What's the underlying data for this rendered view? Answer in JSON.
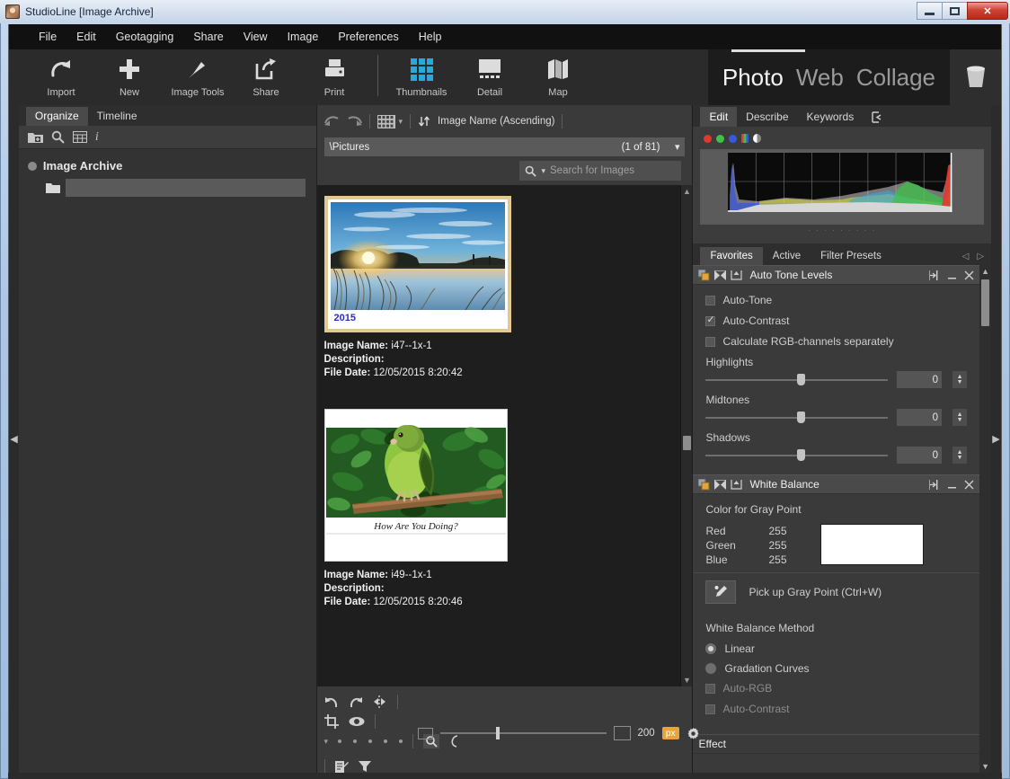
{
  "window": {
    "title": "StudioLine [Image Archive]",
    "buttons": {
      "minimize": "minimize",
      "maximize": "maximize",
      "close": "✕"
    }
  },
  "menubar": {
    "items": [
      "File",
      "Edit",
      "Geotagging",
      "Share",
      "View",
      "Image",
      "Preferences",
      "Help"
    ]
  },
  "toolbar": {
    "items": [
      {
        "label": "Import",
        "icon": "import-arrow-icon"
      },
      {
        "label": "New",
        "icon": "plus-icon"
      },
      {
        "label": "Image Tools",
        "icon": "wand-icon"
      },
      {
        "label": "Share",
        "icon": "share-export-icon"
      },
      {
        "label": "Print",
        "icon": "printer-icon"
      },
      {
        "label": "Thumbnails",
        "icon": "grid-icon"
      },
      {
        "label": "Detail",
        "icon": "detail-icon"
      },
      {
        "label": "Map",
        "icon": "map-icon"
      }
    ],
    "modes": [
      {
        "label": "Photo",
        "active": true
      },
      {
        "label": "Web",
        "active": false
      },
      {
        "label": "Collage",
        "active": false
      }
    ],
    "trash_icon": "trash-icon"
  },
  "left_panel": {
    "tabs": [
      {
        "label": "Organize",
        "active": true
      },
      {
        "label": "Timeline",
        "active": false
      }
    ],
    "icons": [
      "new-folder-icon",
      "search-icon",
      "table-icon",
      "info-icon"
    ],
    "tree": {
      "root_label": "Image Archive",
      "child_label": ""
    }
  },
  "center_panel": {
    "nav": {
      "back_icon": "undo-arrow-icon",
      "forward_icon": "redo-arrow-icon",
      "view_icon": "filmstrip-icon",
      "view_dropdown": "▾",
      "sort_icon": "sort-ascending-icon",
      "sort_label": "Image Name (Ascending)"
    },
    "path": {
      "value": "\\Pictures",
      "count": "(1 of 81)",
      "dropdown": "▾"
    },
    "search": {
      "icon": "search-icon",
      "dropdown": "▾",
      "placeholder": "Search for Images",
      "menu_icon": "hamburger-icon"
    },
    "thumbnails": [
      {
        "caption": "2015",
        "image_alt": "sunset-over-lake-photo",
        "name_label": "Image Name:",
        "name_value": "i47--1x-1",
        "description_label": "Description:",
        "description_value": "",
        "date_label": "File Date:",
        "date_value": "12/05/2015 8:20:42"
      },
      {
        "caption": "How Are You Doing?",
        "image_alt": "green-parrot-on-branch-photo",
        "name_label": "Image Name:",
        "name_value": "i49--1x-1",
        "description_label": "Description:",
        "description_value": "",
        "date_label": "File Date:",
        "date_value": "12/05/2015 8:20:46"
      }
    ],
    "bottom_toolbar": {
      "undo_icon": "undo-icon",
      "redo_icon": "redo-icon",
      "compare_icon": "compare-icon",
      "crop_icon": "crop-icon",
      "eye_icon": "eye-icon",
      "zoom_icon": "zoom-icon",
      "rotate_icon": "rotate-icon",
      "size_value": "200",
      "size_unit": "px",
      "gear_icon": "gear-icon",
      "note_icon": "note-icon",
      "filter_icon": "filter-icon"
    }
  },
  "right_panel": {
    "tabs": [
      {
        "label": "Edit",
        "active": true
      },
      {
        "label": "Describe",
        "active": false
      },
      {
        "label": "Keywords",
        "active": false
      }
    ],
    "tab_detach_icon": "detach-icon",
    "histogram": {
      "channels": [
        "red-channel",
        "green-channel",
        "blue-channel",
        "rgb-channel",
        "luminance-channel"
      ],
      "channel_colors": [
        "#e03a30",
        "#3fc14a",
        "#3a57e0",
        "#cccccc",
        "#ffffff"
      ]
    },
    "subtabs": [
      {
        "label": "Favorites",
        "active": true
      },
      {
        "label": "Active",
        "active": false
      },
      {
        "label": "Filter Presets",
        "active": false
      }
    ],
    "subtab_nav": {
      "prev": "◁",
      "next": "▷"
    },
    "modules": [
      {
        "title": "Auto Tone Levels",
        "head_icons": [
          "copy-icon",
          "reset-icon",
          "upload-icon"
        ],
        "head_buttons": [
          "expand-icon",
          "minimize-icon",
          "close-icon"
        ],
        "checkboxes": [
          {
            "label": "Auto-Tone",
            "checked": false
          },
          {
            "label": "Auto-Contrast",
            "checked": true
          },
          {
            "label": "Calculate RGB-channels separately",
            "checked": false
          }
        ],
        "sliders": [
          {
            "label": "Highlights",
            "value": "0"
          },
          {
            "label": "Midtones",
            "value": "0"
          },
          {
            "label": "Shadows",
            "value": "0"
          }
        ]
      },
      {
        "title": "White Balance",
        "head_icons": [
          "copy-icon",
          "reset-icon",
          "upload-icon"
        ],
        "head_buttons": [
          "expand-icon",
          "minimize-icon",
          "close-icon"
        ],
        "gray_point_label": "Color for Gray Point",
        "rgb": [
          {
            "label": "Red",
            "value": "255"
          },
          {
            "label": "Green",
            "value": "255"
          },
          {
            "label": "Blue",
            "value": "255"
          }
        ],
        "swatch_color": "#ffffff",
        "pick_icon": "eyedropper-icon",
        "pick_label": "Pick up Gray Point (Ctrl+W)",
        "method_label": "White Balance Method",
        "radios": [
          {
            "label": "Linear",
            "selected": true
          },
          {
            "label": "Gradation Curves",
            "selected": false
          }
        ],
        "checkboxes": [
          {
            "label": "Auto-RGB",
            "checked": false
          },
          {
            "label": "Auto-Contrast",
            "checked": false
          }
        ]
      },
      {
        "title": "Effect"
      }
    ]
  },
  "collapse_arrows": {
    "left": "◀",
    "right": "▶"
  },
  "colors": {
    "accent_orange": "#e8a33d",
    "frame_gold": "#e2c98f",
    "panel_bg": "#3a3a3a",
    "dark_bg": "#1e1e1e",
    "caption_blue": "#2b2bbb"
  }
}
